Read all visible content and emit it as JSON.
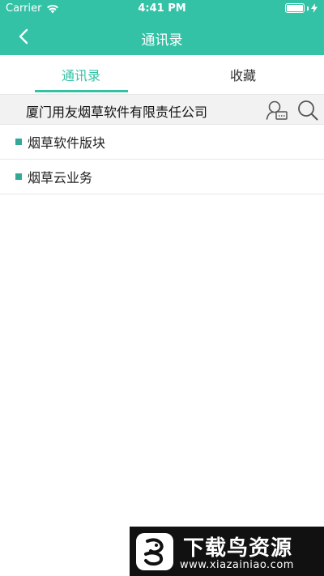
{
  "status_bar": {
    "carrier": "Carrier",
    "time": "4:41 PM",
    "wifi_icon": "wifi-icon",
    "battery_icon": "battery-icon",
    "charging_icon": "bolt-icon",
    "battery_level": 1.0
  },
  "nav": {
    "title": "通讯录",
    "back_icon": "chevron-left-icon"
  },
  "tabs": [
    {
      "label": "通讯录",
      "active": true
    },
    {
      "label": "收藏",
      "active": false
    }
  ],
  "company": {
    "name": "厦门用友烟草软件有限责任公司",
    "contact_card_icon": "contact-card-icon",
    "search_icon": "search-icon"
  },
  "list": {
    "items": [
      {
        "label": "烟草软件版块"
      },
      {
        "label": "烟草云业务"
      }
    ]
  },
  "watermark": {
    "title": "下载鸟资源",
    "url": "www.xiazainiao.com"
  },
  "colors": {
    "accent": "#33c2a6",
    "bullet": "#33a898",
    "company_bar_bg": "#f2f2f2"
  }
}
